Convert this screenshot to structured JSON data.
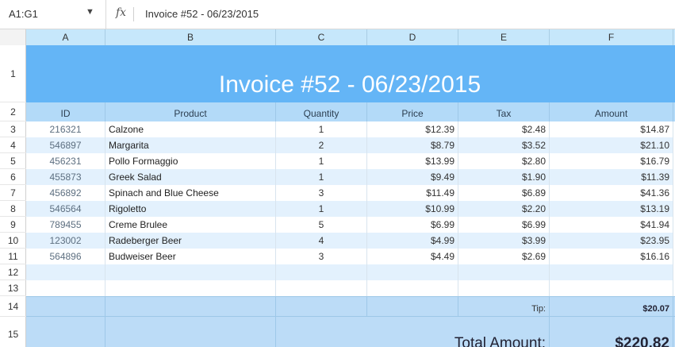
{
  "formula_bar": {
    "name_box": "A1:G1",
    "fx": "fx",
    "formula": "Invoice #52 - 06/23/2015"
  },
  "columns": [
    "A",
    "B",
    "C",
    "D",
    "E",
    "F"
  ],
  "rows": [
    "1",
    "2",
    "3",
    "4",
    "5",
    "6",
    "7",
    "8",
    "9",
    "10",
    "11",
    "12",
    "13",
    "14",
    "15"
  ],
  "title": "Invoice #52 - 06/23/2015",
  "table_headers": [
    "ID",
    "Product",
    "Quantity",
    "Price",
    "Tax",
    "Amount"
  ],
  "items": [
    {
      "id": "216321",
      "product": "Calzone",
      "quantity": "1",
      "price": "$12.39",
      "tax": "$2.48",
      "amount": "$14.87"
    },
    {
      "id": "546897",
      "product": "Margarita",
      "quantity": "2",
      "price": "$8.79",
      "tax": "$3.52",
      "amount": "$21.10"
    },
    {
      "id": "456231",
      "product": "Pollo Formaggio",
      "quantity": "1",
      "price": "$13.99",
      "tax": "$2.80",
      "amount": "$16.79"
    },
    {
      "id": "455873",
      "product": "Greek Salad",
      "quantity": "1",
      "price": "$9.49",
      "tax": "$1.90",
      "amount": "$11.39"
    },
    {
      "id": "456892",
      "product": "Spinach and Blue Cheese",
      "quantity": "3",
      "price": "$11.49",
      "tax": "$6.89",
      "amount": "$41.36"
    },
    {
      "id": "546564",
      "product": "Rigoletto",
      "quantity": "1",
      "price": "$10.99",
      "tax": "$2.20",
      "amount": "$13.19"
    },
    {
      "id": "789455",
      "product": "Creme Brulee",
      "quantity": "5",
      "price": "$6.99",
      "tax": "$6.99",
      "amount": "$41.94"
    },
    {
      "id": "123002",
      "product": "Radeberger Beer",
      "quantity": "4",
      "price": "$4.99",
      "tax": "$3.99",
      "amount": "$23.95"
    },
    {
      "id": "564896",
      "product": "Budweiser Beer",
      "quantity": "3",
      "price": "$4.49",
      "tax": "$2.69",
      "amount": "$16.16"
    }
  ],
  "summary": {
    "tip_label": "Tip:",
    "tip_value": "$20.07",
    "total_label": "Total Amount:",
    "total_value": "$220.82"
  }
}
